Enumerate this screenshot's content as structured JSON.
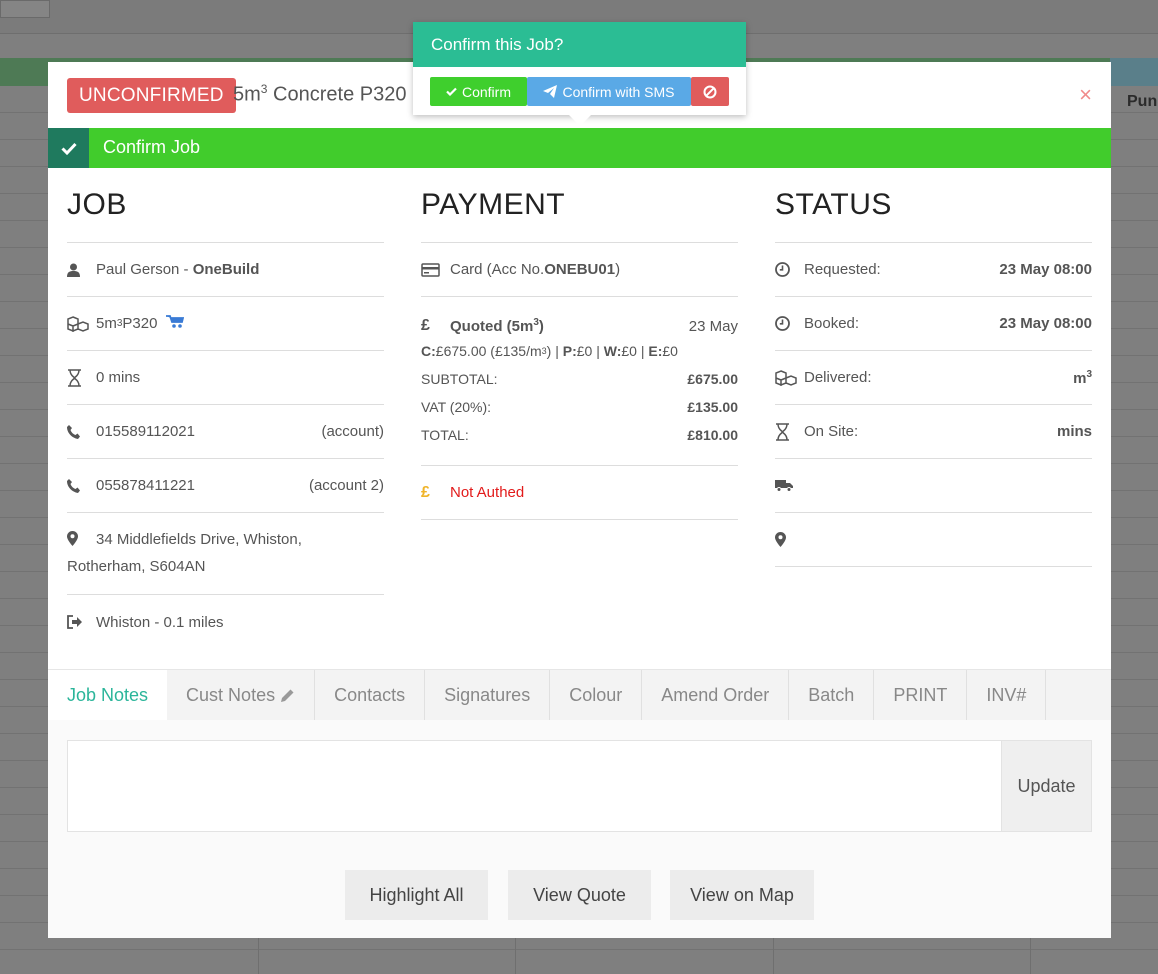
{
  "background": {
    "partial_header_text": "Pun"
  },
  "modal": {
    "status_badge": "UNCONFIRMED",
    "title_prefix": "5m",
    "title_superscript": "3",
    "title_suffix": " Concrete P320",
    "close_symbol": "×",
    "confirm_bar_label": "Confirm Job"
  },
  "popover": {
    "title": "Confirm this Job?",
    "confirm_label": "Confirm",
    "confirm_sms_label": "Confirm with SMS"
  },
  "job": {
    "heading": "JOB",
    "customer_name": "Paul Gerson - ",
    "customer_company": "OneBuild",
    "product_prefix": "5m",
    "product_superscript": "3",
    "product_suffix": " P320",
    "duration": "0 mins",
    "phone1": "015589112021",
    "phone1_label": "(account)",
    "phone2": "055878411221",
    "phone2_label": "(account 2)",
    "address_line1": "34 Middlefields Drive, Whiston,",
    "address_line2": "Rotherham, S604AN",
    "depot_distance": "Whiston - 0.1 miles"
  },
  "payment": {
    "heading": "PAYMENT",
    "method_prefix": "Card (Acc No. ",
    "account_no": "ONEBU01",
    "method_suffix": ")",
    "quoted_label_prefix": "Quoted (5m",
    "quoted_label_sup": "3",
    "quoted_label_suffix": ")",
    "quoted_date": "23 May",
    "breakdown_c_label": "C:",
    "breakdown_c_value_prefix": "£675.00 (£135/m",
    "breakdown_c_value_sup": "3",
    "breakdown_c_value_suffix": ")",
    "breakdown_sep1": " | ",
    "breakdown_p_label": "P:",
    "breakdown_p_value": "£0",
    "breakdown_sep2": " | ",
    "breakdown_w_label": "W:",
    "breakdown_w_value": "£0",
    "breakdown_sep3": " | ",
    "breakdown_e_label": "E:",
    "breakdown_e_value": "£0",
    "subtotal_label": "SUBTOTAL:",
    "subtotal_value": "£675.00",
    "vat_label": "VAT (20%):",
    "vat_value": "£135.00",
    "total_label": "TOTAL:",
    "total_value": "£810.00",
    "auth_status": "Not Authed"
  },
  "status": {
    "heading": "STATUS",
    "requested_label": "Requested:",
    "requested_value": "23 May 08:00",
    "booked_label": "Booked:",
    "booked_value": "23 May 08:00",
    "delivered_label": "Delivered:",
    "delivered_value_prefix": "m",
    "delivered_value_sup": "3",
    "onsite_label": "On Site:",
    "onsite_value": "mins"
  },
  "tabs": [
    "Job Notes",
    "Cust Notes",
    "Contacts",
    "Signatures",
    "Colour",
    "Amend Order",
    "Batch",
    "PRINT",
    "INV#"
  ],
  "notes": {
    "value": "",
    "update_label": "Update"
  },
  "actions": {
    "highlight_all": "Highlight All",
    "view_quote": "View Quote",
    "view_on_map": "View on Map"
  },
  "colors": {
    "unconfirmed_badge": "#e05c5c",
    "confirm_bar": "#41cc2c",
    "confirm_bar_check": "#1f7a5e",
    "popover_header": "#2bbd94",
    "confirm_button": "#3fcf2d",
    "sms_button": "#5aa9e6",
    "cancel_button": "#e05c5c",
    "active_tab": "#2bb59a",
    "not_authed_text": "#e21b1b",
    "pound_icon_unpaid": "#f0b429",
    "van_icon": "#3a7bd5"
  }
}
